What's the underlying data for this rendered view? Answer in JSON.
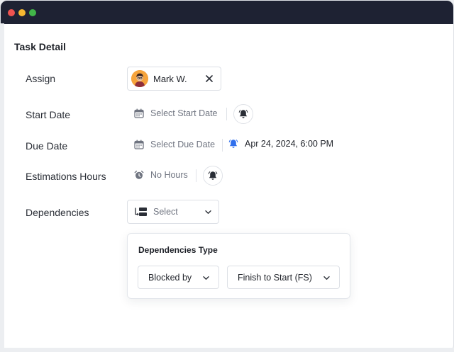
{
  "window": {
    "controls": [
      "close",
      "minimize",
      "maximize"
    ],
    "colors": {
      "titlebar": "#1e2233",
      "close": "#ef5350",
      "minimize": "#f5b731",
      "maximize": "#42b649"
    }
  },
  "page": {
    "title": "Task Detail"
  },
  "assign": {
    "label": "Assign",
    "assignee": {
      "name": "Mark W.",
      "avatar_icon": "user-avatar"
    },
    "remove_icon": "close-icon"
  },
  "start_date": {
    "label": "Start Date",
    "placeholder": "Select Start Date",
    "icon": "calendar-icon",
    "reminder_icon": "bell-icon"
  },
  "due_date": {
    "label": "Due Date",
    "placeholder": "Select Due Date",
    "icon": "calendar-icon",
    "reminder_icon": "bell-icon",
    "reminder_value": "Apr 24, 2024, 6:00 PM",
    "accent": "#2f6fed"
  },
  "estimation": {
    "label": "Estimations Hours",
    "placeholder": "No Hours",
    "icon": "alarm-clock-icon",
    "reminder_icon": "bell-icon"
  },
  "dependencies": {
    "label": "Dependencies",
    "select_placeholder": "Select",
    "icon": "dependency-icon",
    "popover": {
      "title": "Dependencies Type",
      "relation": "Blocked by",
      "type": "Finish to Start (FS)"
    }
  }
}
